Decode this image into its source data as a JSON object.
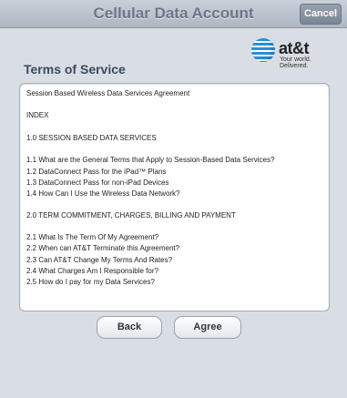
{
  "header": {
    "title": "Cellular Data Account",
    "cancel_label": "Cancel"
  },
  "logo": {
    "name": "at&t",
    "tagline": "Your world. Delivered."
  },
  "section_title": "Terms of Service",
  "document": {
    "lines": [
      "Session Based Wireless Data Services Agreement",
      "INDEX",
      "1.0 SESSION BASED DATA SERVICES",
      "1.1 What are the General Terms that Apply to Session-Based Data Services?",
      "1.2 DataConnect Pass for the iPad™ Plans",
      "1.3 DataConnect Pass for non-iPad Devices",
      "1.4 How Can I Use the Wireless Data Network?",
      "2.0 TERM COMMITMENT, CHARGES, BILLING AND PAYMENT",
      "2.1 What Is The Term Of My Agreement?",
      "2.2 When can AT&T Terminate this Agreement?",
      "2.3 Can AT&T Change My Terms And Rates?",
      "2.4 What Charges Am I Responsible for?",
      "2.5 How do I pay for my Data Services?"
    ]
  },
  "buttons": {
    "back_label": "Back",
    "agree_label": "Agree"
  },
  "colors": {
    "background": "#d9dde4",
    "title_text": "#6d7686",
    "section_title_text": "#3b4a5f",
    "logo_blue": "#2a8fd8"
  }
}
